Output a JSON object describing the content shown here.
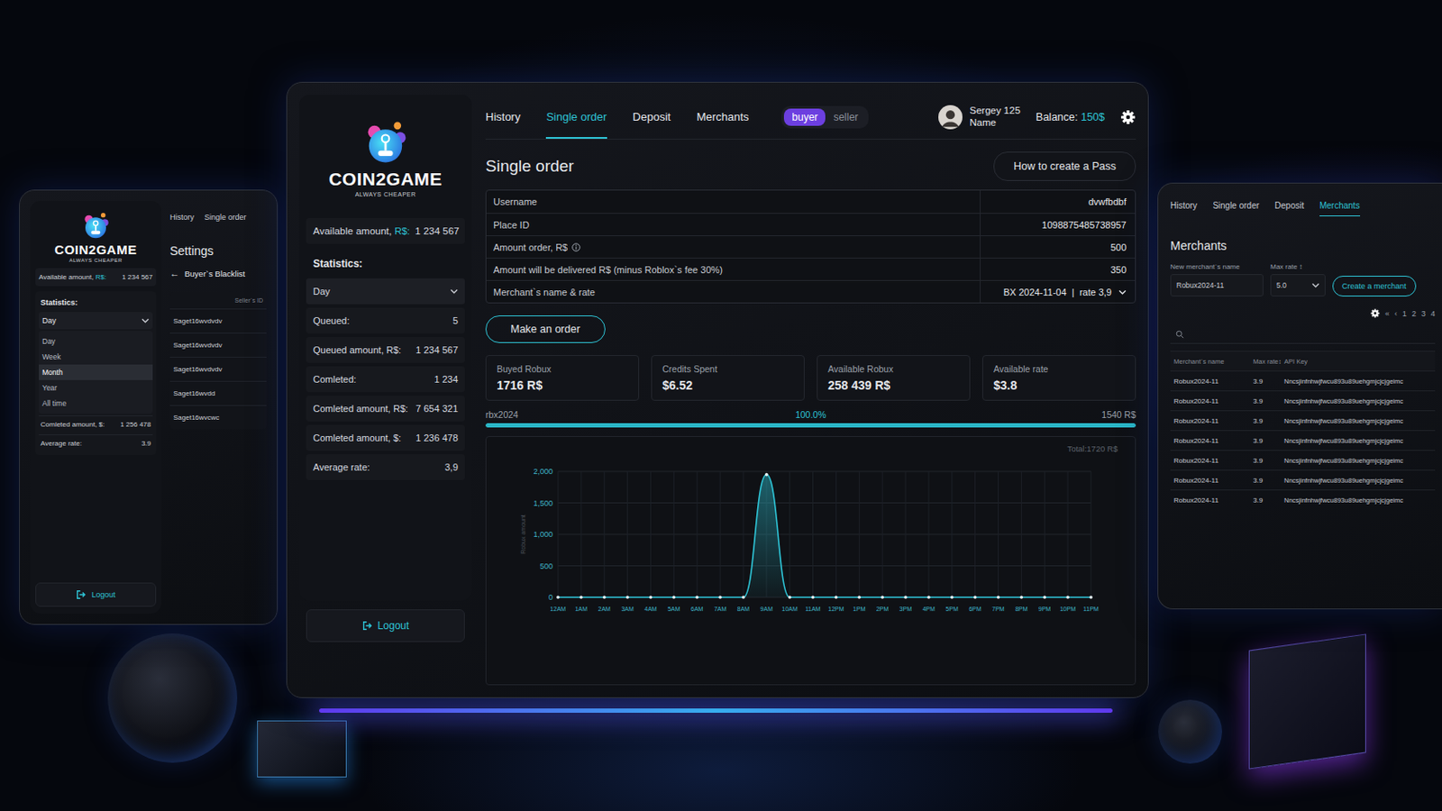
{
  "left_window": {
    "logo": {
      "name": "COIN2GAME",
      "tagline": "ALWAYS CHEAPER"
    },
    "available": {
      "label": "Available amount,",
      "unit": "R$:",
      "value": "1 234 567"
    },
    "statistics_title": "Statistics:",
    "period": {
      "value": "Day",
      "expanded": true,
      "options": [
        {
          "label": "Day",
          "selected": false
        },
        {
          "label": "Week",
          "selected": false
        },
        {
          "label": "Month",
          "selected": true
        },
        {
          "label": "Year",
          "selected": false
        },
        {
          "label": "All time",
          "selected": false
        }
      ]
    },
    "stats": [
      {
        "label": "Comleted amount, $:",
        "value": "1 256 478"
      },
      {
        "label": "Average rate:",
        "value": "3.9"
      }
    ],
    "logout": "Logout",
    "tabs": [
      {
        "label": "History",
        "selected": false
      },
      {
        "label": "Single order",
        "selected": false
      }
    ],
    "title": "Settings",
    "back": "←",
    "subtitle": "Buyer`s Blacklist",
    "column": "Seller`s ID",
    "rows": [
      "Saget16wvdvdv",
      "Saget16wvdvdv",
      "Saget16wvdvdv",
      "Saget16wvdd",
      "Saget16wvcwc"
    ]
  },
  "main_window": {
    "logo": {
      "name": "COIN2GAME",
      "tagline": "ALWAYS CHEAPER"
    },
    "available": {
      "label": "Available amount,",
      "unit": "R$:",
      "value": "1 234 567"
    },
    "statistics_title": "Statistics:",
    "period": {
      "value": "Day",
      "expanded": false
    },
    "stats": [
      {
        "label": "Queued:",
        "value": "5"
      },
      {
        "label": "Queued amount, R$:",
        "value": "1 234 567"
      },
      {
        "label": "Comleted:",
        "value": "1 234"
      },
      {
        "label": "Comleted amount, R$:",
        "value": "7 654 321"
      },
      {
        "label": "Comleted amount, $:",
        "value": "1 236 478"
      },
      {
        "label": "Average rate:",
        "value": "3,9"
      }
    ],
    "logout": "Logout",
    "tabs": [
      {
        "label": "History",
        "selected": false
      },
      {
        "label": "Single order",
        "selected": true
      },
      {
        "label": "Deposit",
        "selected": false
      },
      {
        "label": "Merchants",
        "selected": false
      }
    ],
    "role_toggle": [
      {
        "label": "buyer",
        "selected": true
      },
      {
        "label": "seller",
        "selected": false
      }
    ],
    "user": {
      "name": "Sergey 125",
      "subtitle": "Name"
    },
    "balance": {
      "label": "Balance:",
      "value": "150$"
    },
    "title": "Single order",
    "help_button": "How to create a Pass",
    "form": [
      {
        "label": "Username",
        "value": "dvwfbdbf",
        "kind": "text"
      },
      {
        "label": "Place ID",
        "value": "1098875485738957",
        "kind": "text"
      },
      {
        "label": "Amount order, R$",
        "value": "500",
        "kind": "info"
      },
      {
        "label": "Amount will be delivered R$ (minus Roblox`s fee 30%)",
        "value": "350",
        "kind": "text"
      },
      {
        "label": "Merchant`s name & rate",
        "value": "BX 2024-11-04  |  rate 3,9",
        "kind": "select"
      }
    ],
    "submit": "Make an order",
    "cards": [
      {
        "label": "Buyed Robux",
        "value": "1716 R$"
      },
      {
        "label": "Credits Spent",
        "value": "$6.52"
      },
      {
        "label": "Available Robux",
        "value": "258 439 R$"
      },
      {
        "label": "Available rate",
        "value": "$3.8"
      }
    ],
    "progress": {
      "name": "rbx2024",
      "percent": "100.0%",
      "amount": "1540 R$",
      "level": 1
    },
    "chart": {
      "total": "Total:1720 R$",
      "y_label": "Robux amount",
      "y_ticks": [
        "2,000",
        "1,500",
        "1,000",
        "500",
        "0"
      ],
      "x_labels": [
        "12AM",
        "1AM",
        "2AM",
        "3AM",
        "4AM",
        "5AM",
        "6AM",
        "7AM",
        "8AM",
        "9AM",
        "10AM",
        "11AM",
        "12PM",
        "1PM",
        "2PM",
        "3PM",
        "4PM",
        "5PM",
        "6PM",
        "7PM",
        "8PM",
        "9PM",
        "10PM",
        "11PM"
      ],
      "values": [
        0,
        0,
        0,
        0,
        0,
        0,
        0,
        0,
        0,
        1950,
        0,
        0,
        0,
        0,
        0,
        0,
        0,
        0,
        0,
        0,
        0,
        0,
        0,
        0
      ]
    }
  },
  "right_window": {
    "tabs": [
      {
        "label": "History",
        "selected": false
      },
      {
        "label": "Single order",
        "selected": false
      },
      {
        "label": "Deposit",
        "selected": false
      },
      {
        "label": "Merchants",
        "selected": true
      }
    ],
    "title": "Merchants",
    "name_label": "New merchant`s name",
    "rate_label": "Max rate",
    "sort_icon": "↕",
    "name_value": "Robux2024-11",
    "rate_value": "5.0",
    "create_button": "Create a merchant",
    "pagination": [
      "«",
      "‹",
      "1",
      "2",
      "3",
      "4"
    ],
    "columns": [
      {
        "label": "Merchant`s name",
        "sortable": false
      },
      {
        "label": "Max rate",
        "sortable": true
      },
      {
        "label": "API Key",
        "sortable": false
      }
    ],
    "rows": [
      {
        "name": "Robux2024-11",
        "rate": "3.9",
        "key": "Nncsjinfnhwjfwcu893u89uehgmjcjcjgeimc"
      },
      {
        "name": "Robux2024-11",
        "rate": "3.9",
        "key": "Nncsjinfnhwjfwcu893u89uehgmjcjcjgeimc"
      },
      {
        "name": "Robux2024-11",
        "rate": "3.9",
        "key": "Nncsjinfnhwjfwcu893u89uehgmjcjcjgeimc"
      },
      {
        "name": "Robux2024-11",
        "rate": "3.9",
        "key": "Nncsjinfnhwjfwcu893u89uehgmjcjcjgeimc"
      },
      {
        "name": "Robux2024-11",
        "rate": "3.9",
        "key": "Nncsjinfnhwjfwcu893u89uehgmjcjcjgeimc"
      },
      {
        "name": "Robux2024-11",
        "rate": "3.9",
        "key": "Nncsjinfnhwjfwcu893u89uehgmjcjcjgeimc"
      },
      {
        "name": "Robux2024-11",
        "rate": "3.9",
        "key": "Nncsjinfnhwjfwcu893u89uehgmjcjcjgeimc"
      }
    ]
  }
}
